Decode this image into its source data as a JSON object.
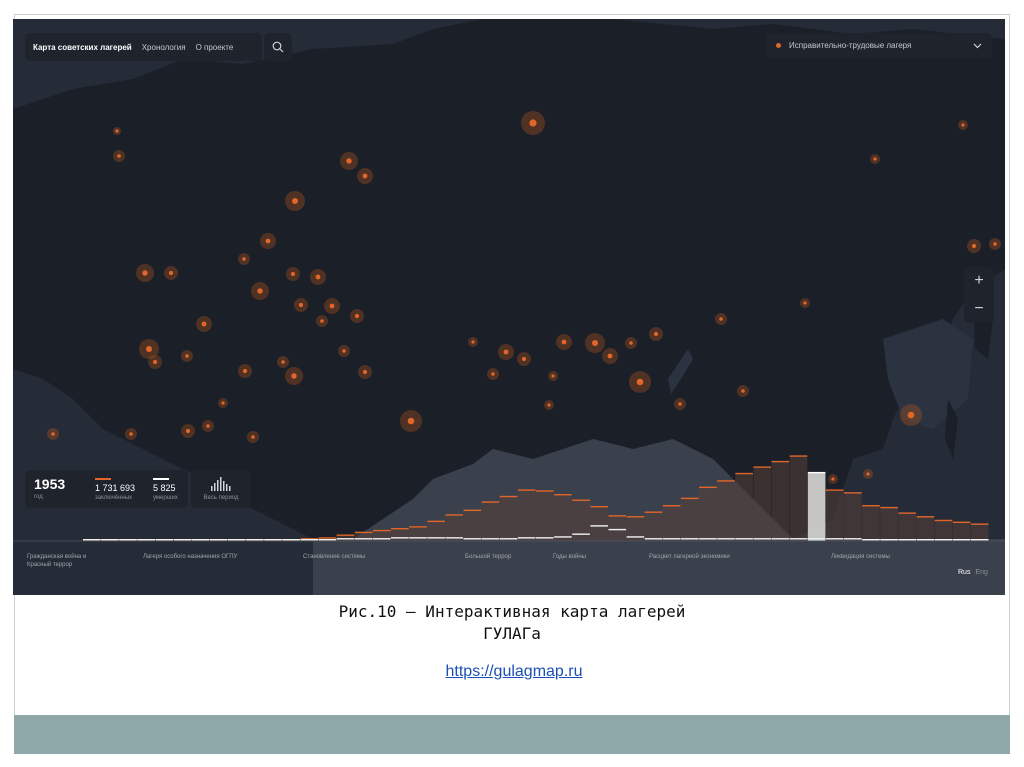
{
  "app": {
    "nav": [
      "Карта советских лагерей",
      "Хронология",
      "О проекте"
    ],
    "filter_label": "Исправительно-трудовые лагеря",
    "zoom_in": "+",
    "zoom_out": "−"
  },
  "stats": {
    "year": "1953",
    "year_label": "год",
    "prisoners_value": "1 731 693",
    "prisoners_label": "заключённых",
    "deaths_value": "5 825",
    "deaths_label": "умерших",
    "period_label": "Весь период"
  },
  "timeline": {
    "periods": [
      "Гражданская война и Красный террор",
      "Лагеря особого назначения ОГПУ",
      "Становление системы",
      "Большой террор",
      "Годы войны",
      "Расцвет лагерной экономики",
      "Ликвидация системы"
    ],
    "prisoner_levels": [
      1,
      1,
      1,
      1,
      1,
      1,
      1,
      1,
      1,
      1,
      1,
      1,
      2,
      3,
      6,
      9,
      11,
      13,
      15,
      21,
      28,
      33,
      42,
      48,
      55,
      54,
      50,
      44,
      37,
      27,
      26,
      31,
      38,
      46,
      58,
      65,
      73,
      80,
      86,
      92,
      74,
      55,
      52,
      38,
      36,
      30,
      26,
      22,
      20,
      18
    ],
    "death_levels": [
      0,
      0,
      0,
      0,
      0,
      0,
      0,
      0,
      0,
      0,
      0,
      0,
      0,
      0,
      1,
      1,
      1,
      2,
      2,
      2,
      2,
      1,
      1,
      1,
      2,
      2,
      3,
      6,
      15,
      11,
      3,
      1,
      1,
      1,
      1,
      1,
      1,
      1,
      1,
      1,
      1,
      1,
      1,
      0,
      0,
      0,
      0,
      0,
      0,
      0
    ],
    "selected_index": 40
  },
  "languages": [
    "Rus",
    "Eng"
  ],
  "colors": {
    "accent": "#e0662a",
    "map_bg": "#252c37",
    "land": "#1a1f28",
    "panel": "#1e232c"
  },
  "icons": [
    "search-icon",
    "chevron-down-icon",
    "zoom-in-icon",
    "zoom-out-icon",
    "histogram-icon"
  ],
  "caption": {
    "line1": "Рис.10 – Интерактивная карта лагерей",
    "line2": "ГУЛАГа"
  },
  "link": "https://gulagmap.ru"
}
